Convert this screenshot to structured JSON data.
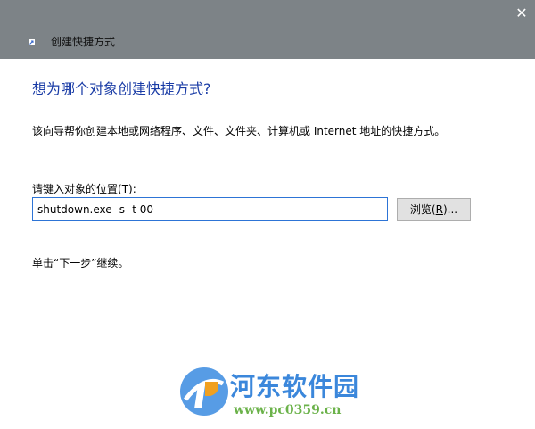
{
  "window": {
    "title": "创建快捷方式",
    "close_glyph": "✕"
  },
  "wizard": {
    "heading": "想为哪个对象创建快捷方式?",
    "description": "该向导帮你创建本地或网络程序、文件、文件夹、计算机或 Internet 地址的快捷方式。",
    "location_label_prefix": "请键入对象的位置(",
    "location_label_accel": "T",
    "location_label_suffix": "):",
    "location_value": "shutdown.exe -s -t 00",
    "browse_prefix": "浏览(",
    "browse_accel": "R",
    "browse_suffix": ")...",
    "hint": "单击“下一步”继续。"
  },
  "watermark": {
    "title": "河东软件园",
    "url": "www.pc0359.cn"
  },
  "colors": {
    "titlebar": "#7d8387",
    "heading": "#1a3ca6",
    "input_border": "#2d74d6",
    "watermark_blue": "#2b7dd8",
    "watermark_green": "#6bb24a"
  },
  "icons": {
    "wizard": "shortcut-wizard-icon",
    "close": "close-icon",
    "watermark_logo": "watermark-logo-icon"
  }
}
